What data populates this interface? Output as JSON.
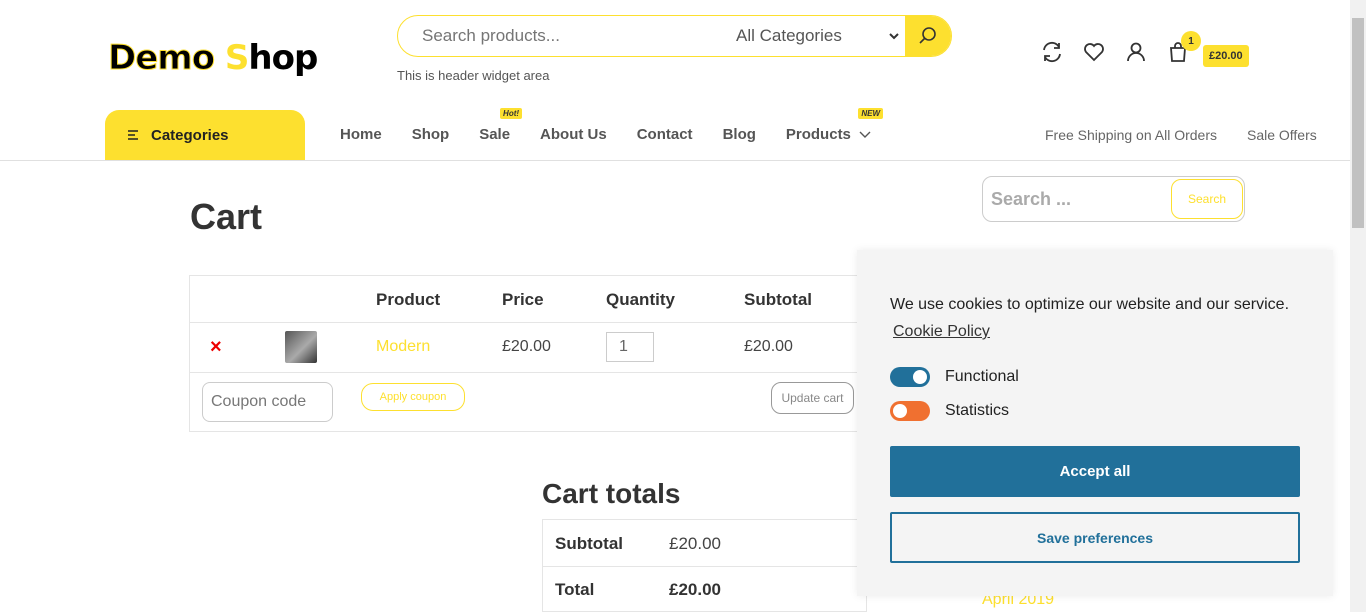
{
  "header": {
    "logo": {
      "part1": "Demo",
      "part2": "S",
      "part3": "hop"
    },
    "search": {
      "placeholder": "Search products...",
      "category": "All Categories"
    },
    "widget_note": "This is header widget area",
    "cart": {
      "count": "1",
      "total": "£20.00"
    }
  },
  "nav": {
    "categories_label": "Categories",
    "items": [
      {
        "label": "Home"
      },
      {
        "label": "Shop"
      },
      {
        "label": "Sale",
        "tag": "Hot!"
      },
      {
        "label": "About Us"
      },
      {
        "label": "Contact"
      },
      {
        "label": "Blog"
      },
      {
        "label": "Products",
        "tag": "NEW"
      }
    ],
    "right": [
      "Free Shipping on All Orders",
      "Sale Offers"
    ]
  },
  "page": {
    "title": "Cart"
  },
  "cart_table": {
    "headers": [
      "Product",
      "Price",
      "Quantity",
      "Subtotal"
    ],
    "row": {
      "remove": "×",
      "product": "Modern",
      "price": "£20.00",
      "quantity": "1",
      "subtotal": "£20.00"
    },
    "coupon_placeholder": "Coupon code",
    "apply_label": "Apply coupon",
    "update_label": "Update cart"
  },
  "totals": {
    "title": "Cart totals",
    "subtotal_label": "Subtotal",
    "subtotal_value": "£20.00",
    "total_label": "Total",
    "total_value": "£20.00"
  },
  "sidebar": {
    "search_placeholder": "Search ...",
    "search_button": "Search",
    "archive_item": "April 2019"
  },
  "cookie": {
    "message": "We use cookies to optimize our website and our service.",
    "policy_link": "Cookie Policy",
    "functional": "Functional",
    "statistics": "Statistics",
    "accept_label": "Accept all",
    "save_label": "Save preferences",
    "colors": {
      "primary": "#21709a",
      "statistics": "#f07030"
    }
  },
  "colors": {
    "accent": "#fde02f"
  }
}
